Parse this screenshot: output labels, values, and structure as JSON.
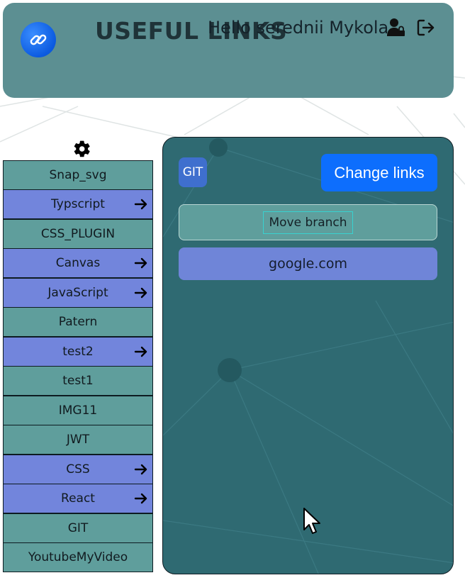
{
  "header": {
    "title": "USEFUL LINKS",
    "greeting": "Hello serednii Mykola",
    "logo_icon": "link-icon",
    "user_icon": "user-lock-icon",
    "logout_icon": "logout-icon"
  },
  "settings": {
    "icon": "gear-icon"
  },
  "sidebar": {
    "items": [
      {
        "label": "Snap_svg",
        "color": "teal",
        "has_arrow": false
      },
      {
        "label": "Typscript",
        "color": "blue",
        "has_arrow": true
      },
      {
        "label": "CSS_PLUGIN",
        "color": "teal",
        "has_arrow": false
      },
      {
        "label": "Canvas",
        "color": "blue",
        "has_arrow": true
      },
      {
        "label": "JavaScript",
        "color": "blue",
        "has_arrow": true
      },
      {
        "label": "Patern",
        "color": "teal",
        "has_arrow": false
      },
      {
        "label": "test2",
        "color": "blue",
        "has_arrow": true
      },
      {
        "label": "test1",
        "color": "teal",
        "has_arrow": false
      },
      {
        "label": "IMG11",
        "color": "teal",
        "has_arrow": false
      },
      {
        "label": "JWT",
        "color": "teal",
        "has_arrow": false
      },
      {
        "label": "CSS",
        "color": "blue",
        "has_arrow": true
      },
      {
        "label": "React",
        "color": "blue",
        "has_arrow": true
      },
      {
        "label": "GIT",
        "color": "teal",
        "has_arrow": false
      },
      {
        "label": "YoutubeMyVideo",
        "color": "teal",
        "has_arrow": false
      }
    ]
  },
  "panel": {
    "badge": "GIT",
    "change_button": "Change links",
    "move_branch": "Move branch",
    "links": [
      "google.com"
    ]
  },
  "colors": {
    "header_bg": "#5c8f92",
    "panel_bg": "#2f6a72",
    "teal_item": "#5f9e9c",
    "blue_item": "#7285dc",
    "primary_button": "#0d6efd",
    "badge_bg": "#3f6fce"
  }
}
